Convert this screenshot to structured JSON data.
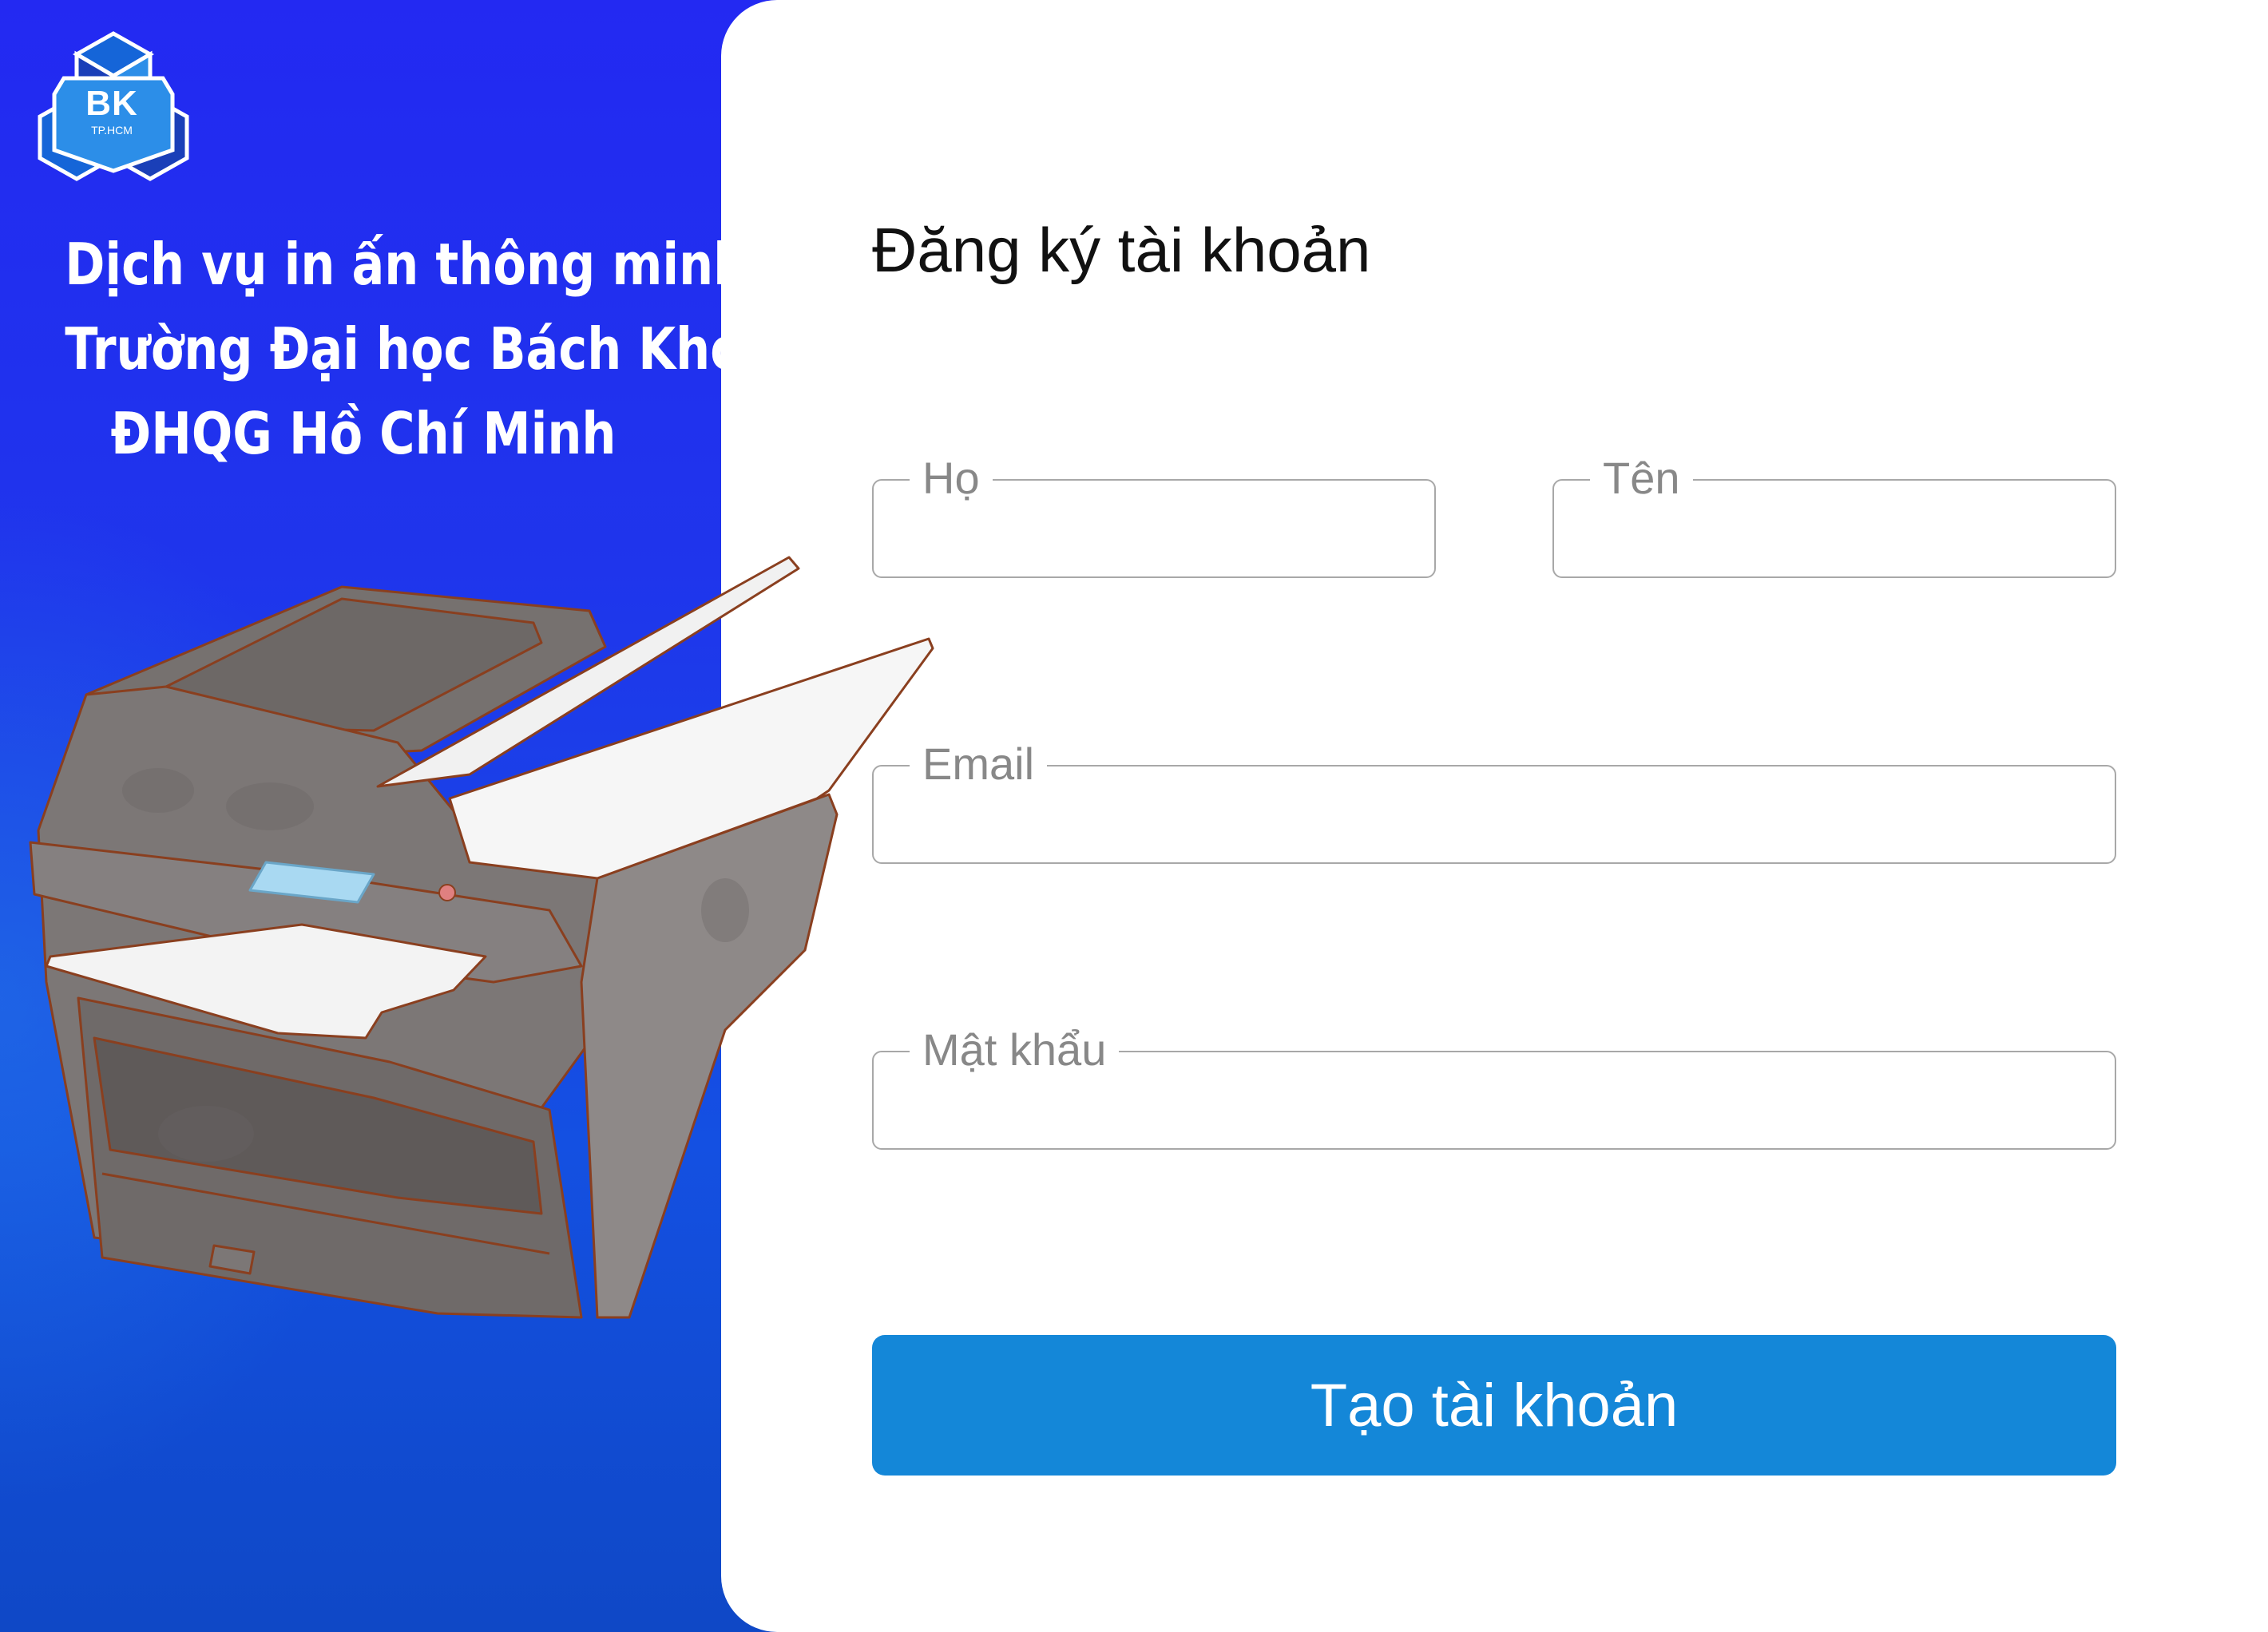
{
  "brand": {
    "logo_text": "BK",
    "logo_subtext": "TP.HCM",
    "tagline_lines": [
      "Dịch vụ in ấn thông minh",
      "Trường Đại học Bách Khoa",
      "ĐHQG Hồ Chí Minh"
    ]
  },
  "form": {
    "title": "Đăng ký tài khoản",
    "fields": {
      "last_name": {
        "label": "Họ",
        "value": ""
      },
      "first_name": {
        "label": "Tên",
        "value": ""
      },
      "email": {
        "label": "Email",
        "value": ""
      },
      "password": {
        "label": "Mật khẩu",
        "value": ""
      }
    },
    "submit_label": "Tạo tài khoản"
  },
  "illustration": {
    "icon": "printer-illustration"
  },
  "colors": {
    "panel_blue": "#2329f2",
    "button_blue": "#1487d8",
    "printer_gray": "#7a7574",
    "outline_brown": "#8a3f1f"
  }
}
